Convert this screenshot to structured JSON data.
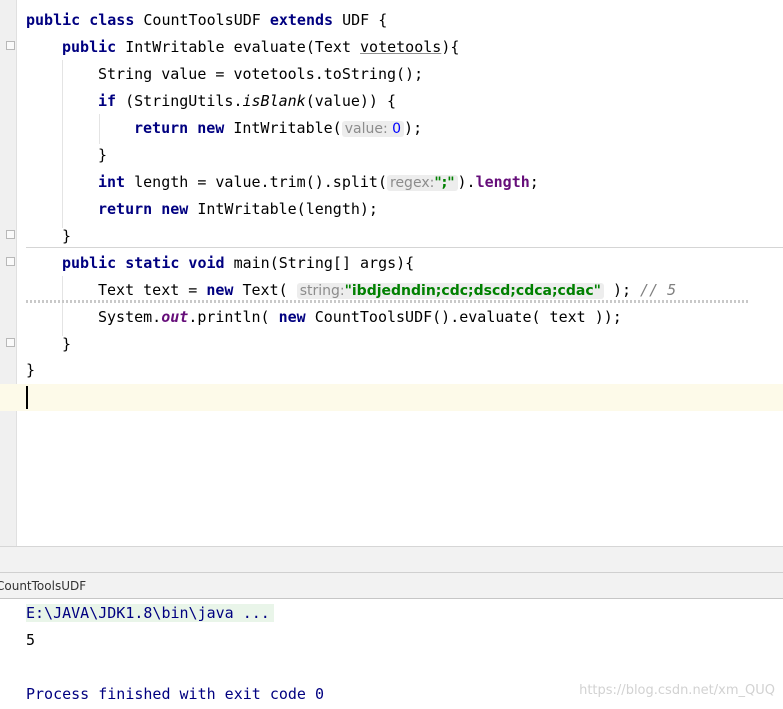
{
  "editor": {
    "lines": {
      "l1": {
        "kw1": "public class ",
        "cls": "CountToolsUDF ",
        "kw2": "extends ",
        "rest": "UDF {"
      },
      "l2": {
        "kw1": "public ",
        "t1": "IntWritable evaluate(Text ",
        "p1": "votetools",
        "t2": "){"
      },
      "l3": {
        "t1": "String value = votetools.toString();"
      },
      "l4": {
        "kw1": "if ",
        "t1": "(StringUtils.",
        "m1": "isBlank",
        "t2": "(value)) {"
      },
      "l5": {
        "kw1": "return new ",
        "t1": "IntWritable(",
        "hint": "value:",
        "num": " 0",
        "t2": ");"
      },
      "l6": {
        "t1": "}"
      },
      "l7": {
        "kw1": "int ",
        "t1": "length = value.trim().split(",
        "hint": "regex:",
        "str": "\";\"",
        "t2": ").",
        "f1": "length",
        "t3": ";"
      },
      "l8": {
        "kw1": "return new ",
        "t1": "IntWritable(length);"
      },
      "l9": {
        "t1": "}"
      },
      "l10": {
        "kw1": "public static void ",
        "t1": "main(String[] args){"
      },
      "l11": {
        "t1": "Text text = ",
        "kw1": "new ",
        "t2": "Text( ",
        "hint": "string:",
        "str": "\"ibdjedndin;cdc;dscd;cdca;cdac\"",
        "t3": " ); ",
        "cmt": "// 5"
      },
      "l12": {
        "t1": "System.",
        "f1": "out",
        "t2": ".println( ",
        "kw1": "new ",
        "t3": "CountToolsUDF().evaluate( text ));"
      },
      "l13": {
        "t1": "}"
      },
      "l14": {
        "t1": "}"
      }
    }
  },
  "run_panel": {
    "tab_label": "CountToolsUDF"
  },
  "console": {
    "command": "E:\\JAVA\\JDK1.8\\bin\\java ...",
    "output": "5",
    "exit_message": "Process finished with exit code 0"
  },
  "watermark": "https://blog.csdn.net/xm_QUQ"
}
